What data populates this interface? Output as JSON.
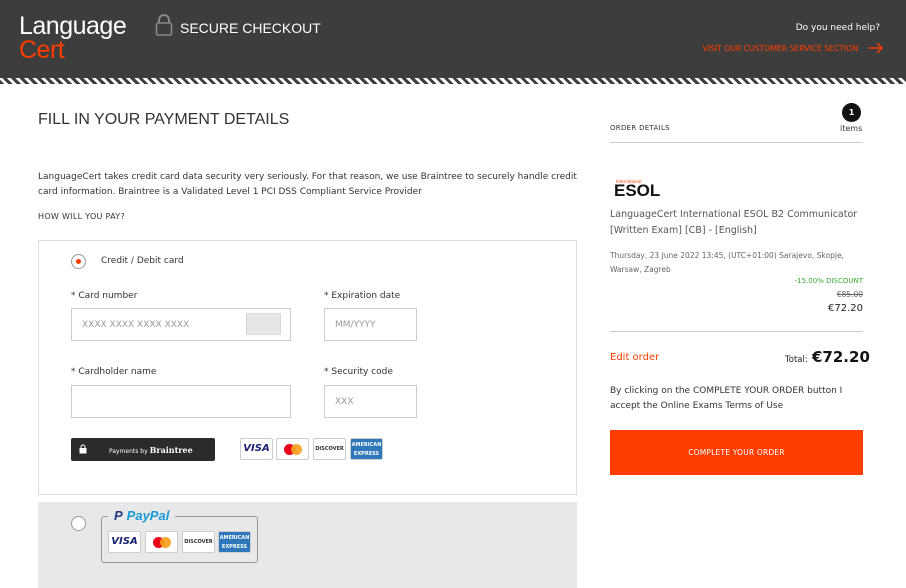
{
  "header": {
    "logo_line1": "Language",
    "logo_line2": "Cert",
    "secure_checkout": "SECURE CHECKOUT",
    "help_question": "Do you need help?",
    "help_link": "VISIT OUR CUSTOMER SERVICE SECTION",
    "icons": [
      "lock-icon",
      "arrow-right-icon"
    ]
  },
  "payment": {
    "title": "FILL IN YOUR PAYMENT DETAILS",
    "intro": "LanguageCert takes credit card data security very seriously. For that reason, we use Braintree to securely handle credit card information. Braintree is a Validated Level 1 PCI DSS Compliant Service Provider",
    "how_label": "HOW WILL YOU PAY?",
    "card_option_label": "Credit / Debit card",
    "card_number_label": "* Card number",
    "card_number_placeholder": "XXXX XXXX XXXX XXXX",
    "expiration_label": "* Expiration date",
    "expiration_placeholder": "MM/YYYY",
    "cardholder_label": "* Cardholder name",
    "cardholder_placeholder": "",
    "security_label": "* Security code",
    "security_placeholder": "XXX",
    "braintree_badge_prefix": "Payments by",
    "braintree_badge_brand": "Braintree",
    "card_brands": [
      "VISA",
      "MasterCard",
      "DISCOVER",
      "AMERICAN EXPRESS"
    ],
    "paypal_label": "PayPal",
    "selected_method": "card",
    "colors": {
      "accent": "#ff3d00",
      "header": "#3d3d3d",
      "discount": "#3aaa35"
    }
  },
  "order": {
    "label": "ORDER DETAILS",
    "count": "1",
    "items_label": "items",
    "brand_small": "International",
    "brand": "ESOL",
    "product": "LanguageCert International ESOL B2 Communicator [Written Exam] [CB] - [English]",
    "date": "Thursday, 23 June 2022 13:45, (UTC+01:00) Sarajevo, Skopje, Warsaw, Zagreb",
    "discount": "-15.00% DISCOUNT",
    "old_price": "€85.00",
    "price": "€72.20",
    "edit_label": "Edit order",
    "total_label": "Total:",
    "total_value": "€72.20",
    "terms": "By clicking on the COMPLETE YOUR ORDER button I accept the Online Exams Terms of Use",
    "complete_label": "COMPLETE YOUR ORDER"
  }
}
